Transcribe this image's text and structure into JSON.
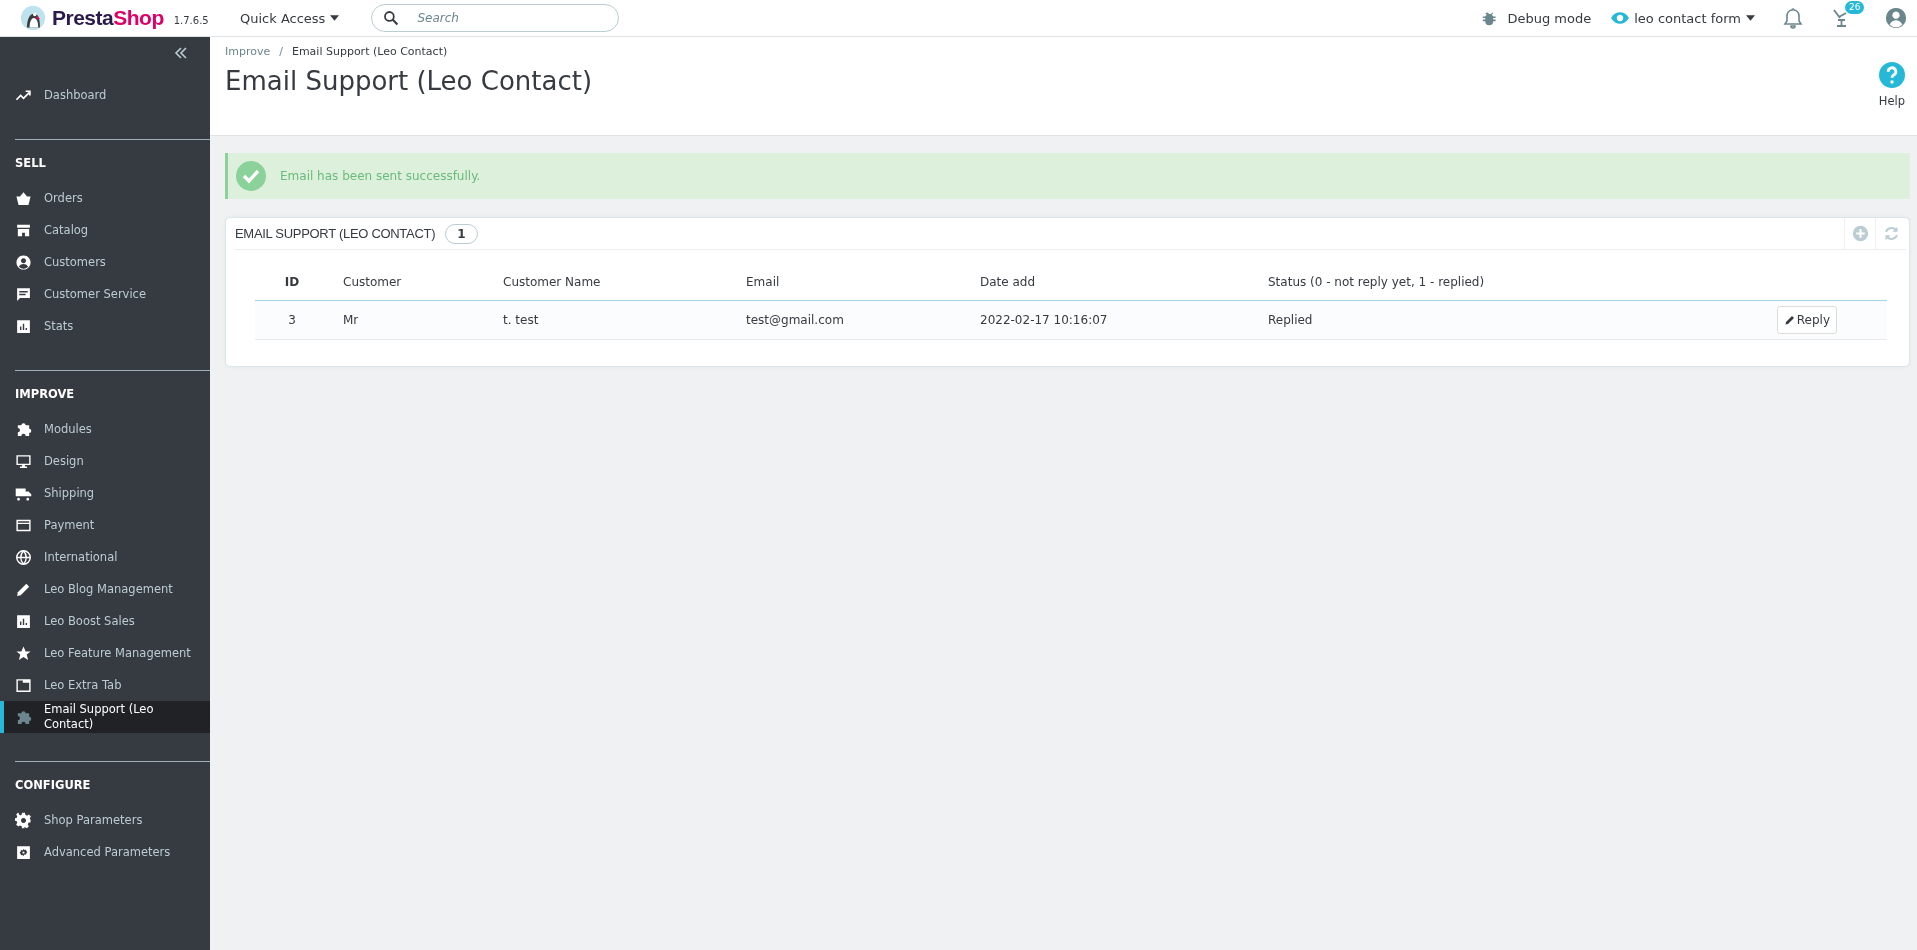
{
  "header": {
    "logo": [
      "Presta",
      "Shop"
    ],
    "version": "1.7.6.5",
    "quick_access": "Quick Access",
    "search": {
      "placeholder": "Search"
    },
    "debug": "Debug mode",
    "shop": "leo contact form",
    "orders_badge": "26"
  },
  "sidebar": {
    "top_items": [
      {
        "label": "Dashboard",
        "selected": false
      }
    ],
    "sections": [
      {
        "title": "SELL",
        "items": [
          {
            "label": "Orders",
            "selected": false
          },
          {
            "label": "Catalog",
            "selected": false
          },
          {
            "label": "Customers",
            "selected": false
          },
          {
            "label": "Customer Service",
            "selected": false
          },
          {
            "label": "Stats",
            "selected": false
          }
        ]
      },
      {
        "title": "IMPROVE",
        "items": [
          {
            "label": "Modules",
            "selected": false
          },
          {
            "label": "Design",
            "selected": false
          },
          {
            "label": "Shipping",
            "selected": false
          },
          {
            "label": "Payment",
            "selected": false
          },
          {
            "label": "International",
            "selected": false
          },
          {
            "label": "Leo Blog Management",
            "selected": false
          },
          {
            "label": "Leo Boost Sales",
            "selected": false
          },
          {
            "label": "Leo Feature Management",
            "selected": false
          },
          {
            "label": "Leo Extra Tab",
            "selected": false
          },
          {
            "label": "Email Support (Leo Contact)",
            "selected": true
          }
        ]
      },
      {
        "title": "CONFIGURE",
        "items": [
          {
            "label": "Shop Parameters",
            "selected": false
          },
          {
            "label": "Advanced Parameters",
            "selected": false
          }
        ]
      }
    ]
  },
  "breadcrumb": {
    "items": [
      "Improve",
      "Email Support (Leo Contact)"
    ],
    "separator": "/"
  },
  "page_title": "Email Support (Leo Contact)",
  "help": "Help",
  "alert": {
    "message": "Email has been sent successfully."
  },
  "panel": {
    "title": "EMAIL SUPPORT (LEO CONTACT)",
    "count": "1",
    "columns": [
      "ID",
      "Customer",
      "Customer Name",
      "Email",
      "Date add",
      "Status (0 - not reply yet, 1 - replied)"
    ],
    "rows": [
      {
        "cells": [
          "3",
          "Mr",
          "t. test",
          "test@gmail.com",
          "2022-02-17 10:16:07",
          "Replied"
        ],
        "action": "Reply"
      }
    ]
  }
}
